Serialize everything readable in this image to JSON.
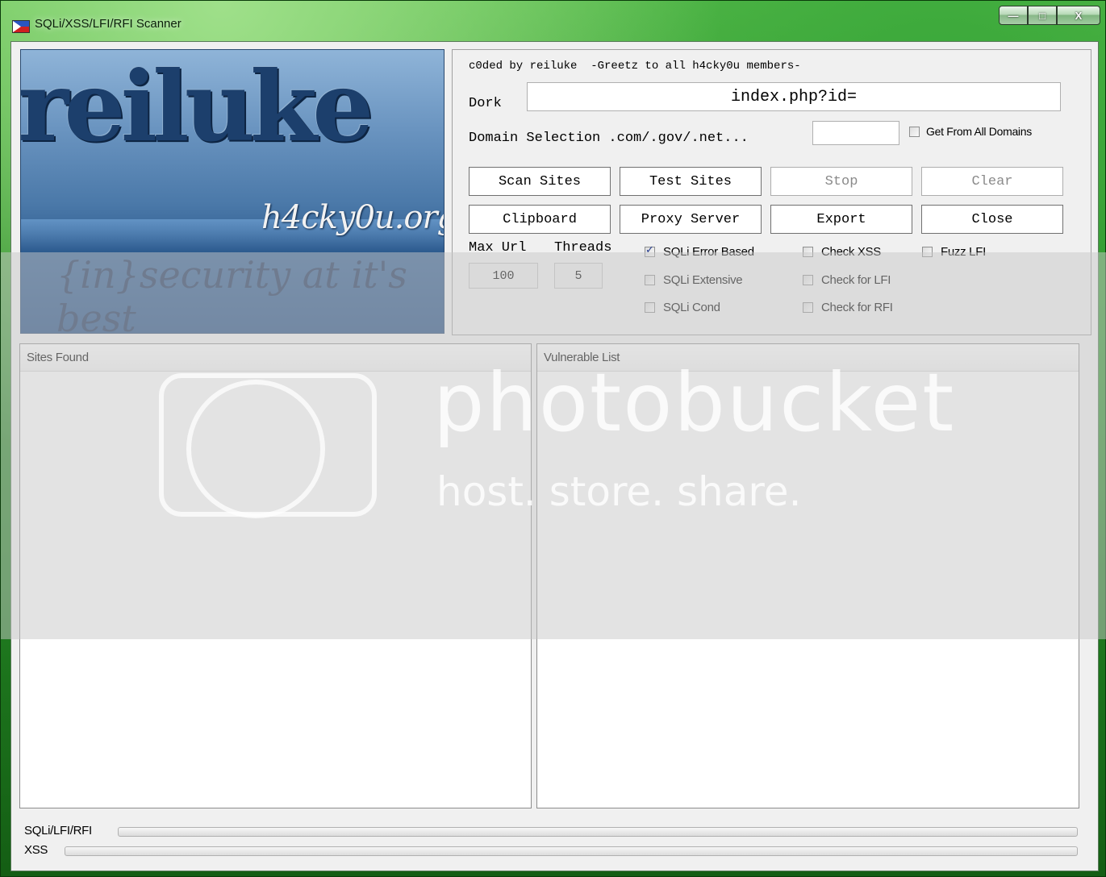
{
  "window": {
    "title": "SQLi/XSS/LFI/RFI Scanner",
    "controls": {
      "minimize": "—",
      "maximize": "□",
      "close": "X"
    }
  },
  "logo": {
    "name": "reiluke",
    "site": "h4cky0u.org",
    "tagline": "{in}security at it's best"
  },
  "header": {
    "credit": "c0ded by reiluke  -Greetz to all h4cky0u members-"
  },
  "dork": {
    "label": "Dork",
    "value": "index.php?id="
  },
  "domain": {
    "label": "Domain Selection .com/.gov/.net...",
    "value": "",
    "all_domains_label": "Get From All Domains",
    "all_domains_checked": false
  },
  "buttons": {
    "scan_sites": "Scan Sites",
    "test_sites": "Test Sites",
    "stop": "Stop",
    "clear": "Clear",
    "clipboard": "Clipboard",
    "proxy_server": "Proxy Server",
    "export": "Export",
    "close": "Close"
  },
  "options": {
    "max_url_label": "Max Url",
    "max_url_value": "100",
    "threads_label": "Threads",
    "threads_value": "5",
    "checks": [
      {
        "label": "SQLi Error Based",
        "checked": true
      },
      {
        "label": "SQLi Extensive",
        "checked": false
      },
      {
        "label": "SQLi Cond",
        "checked": false
      },
      {
        "label": "Check XSS",
        "checked": false
      },
      {
        "label": "Check for LFI",
        "checked": false
      },
      {
        "label": "Check for RFI",
        "checked": false
      },
      {
        "label": "Fuzz LFI",
        "checked": false
      }
    ]
  },
  "lists": {
    "sites_found": "Sites Found",
    "vulnerable_list": "Vulnerable List"
  },
  "progress": {
    "sqli_label": "SQLi/LFI/RFI",
    "sqli_value": 0,
    "xss_label": "XSS",
    "xss_value": 0
  },
  "watermark": {
    "brand": "photobucket",
    "slogan": "host. store. share."
  }
}
